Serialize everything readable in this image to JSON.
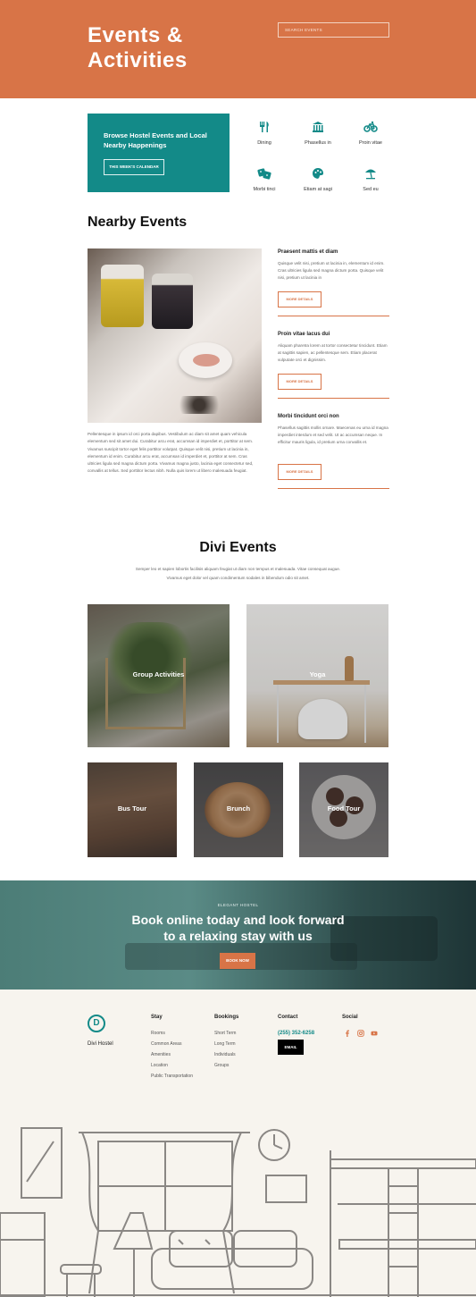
{
  "header": {
    "title": "Events & Activities",
    "search_placeholder": "SEARCH EVENTS"
  },
  "browse": {
    "title": "Browse Hostel Events and Local Nearby Happenings",
    "button": "THIS WEEK'S CALENDAR"
  },
  "categories": [
    {
      "label": "Dining",
      "icon": "fork-knife-icon"
    },
    {
      "label": "Phasellus in",
      "icon": "museum-icon"
    },
    {
      "label": "Proin vitae",
      "icon": "bicycle-icon"
    },
    {
      "label": "Morbi tinci",
      "icon": "dice-icon"
    },
    {
      "label": "Etiam at sagi",
      "icon": "palette-icon"
    },
    {
      "label": "Sed eu",
      "icon": "beach-umbrella-icon"
    }
  ],
  "nearby": {
    "title": "Nearby Events",
    "body": "Pellentesque in ipsum id orci porta dapibus. Vestibulum ac diam sit amet quam vehicula elementum sed sit amet dui. Curabitur arcu erat, accumsan id imperdiet et, porttitor at sem. Vivamus suscipit tortor eget felis porttitor volutpat. Quisque velit nisi, pretium ut lacinia in, elementum id enim. Curabitur arcu erat, accumsan id imperdiet et, porttitor at sem. Cras ultricies ligula sed magna dictum porta. Vivamus magna justo, lacinia eget consectetur sed, convallis at tellus. Sed porttitor lectus nibh. Nulla quis lorem ut libero malesuada feugiat.",
    "events": [
      {
        "title": "Praesent mattis et diam",
        "desc": "Quisque velit nisi, pretium ut lacinia in, elementum id enim. Cras ultricies ligula sed magna dictum porta. Quisque velit nisi, pretium ut lacinia in",
        "button": "MORE DETAILS"
      },
      {
        "title": "Proin vitae lacus dui",
        "desc": "Aliquam pharetra lorem at tortor consectetur tincidunt. Etiam at sagittis sapien, ac pellentesque sem. Etiam placerat vulputate orci et dignissim.",
        "button": "MORE DETAILS"
      },
      {
        "title": "Morbi tincidunt orci non",
        "desc": "Phasellus sagittis mollis ornare. Maecenas eu urna id magna imperdiet interdum et sed velit. Ut ac accumsan neque. In efficitur mauris ligula, id pretium urna convallis et.",
        "button": "MORE DETAILS"
      }
    ]
  },
  "divi": {
    "title": "Divi Events",
    "desc": "Semper leo et sapien lobortis facilisis aliquam feugiat ut diam non tempus et malesuada. Vitae consequat augue. Vivamus eget dolor vel quam condimentum sodales in bibendum odio sit amet.",
    "tiles": [
      "Group Activities",
      "Yoga",
      "Bus Tour",
      "Brunch",
      "Food Tour"
    ]
  },
  "cta": {
    "kicker": "ELEGANT HOSTEL",
    "title_line1": "Book online today and look forward",
    "title_line2": "to a relaxing stay with us",
    "button": "BOOK NOW"
  },
  "footer": {
    "logo_letter": "D",
    "brand": "Divi Hostel",
    "stay": {
      "heading": "Stay",
      "links": [
        "Rooms",
        "Common Areas",
        "Amenities",
        "Location",
        "Public Transportation"
      ]
    },
    "bookings": {
      "heading": "Bookings",
      "links": [
        "Short Term",
        "Long Term",
        "Individuals",
        "Groups"
      ]
    },
    "contact": {
      "heading": "Contact",
      "phone": "(255) 352-6258",
      "email_button": "EMAIL"
    },
    "social": {
      "heading": "Social",
      "icons": [
        "facebook-icon",
        "instagram-icon",
        "youtube-icon"
      ]
    }
  },
  "colors": {
    "accent": "#d87447",
    "teal": "#138a88"
  }
}
